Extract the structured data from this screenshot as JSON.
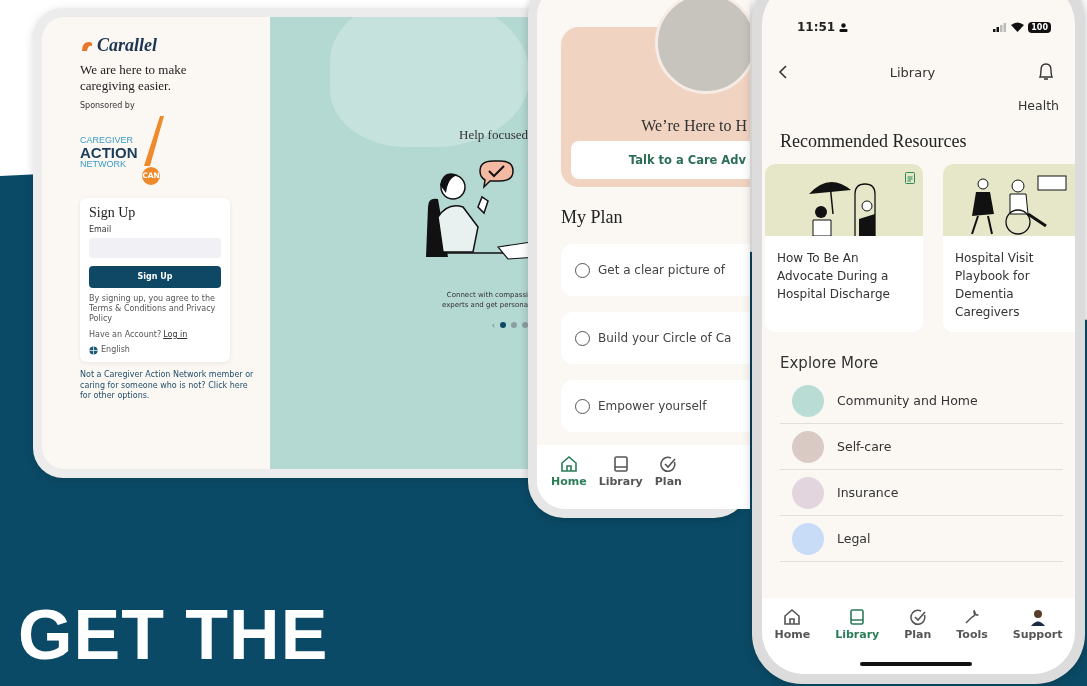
{
  "headline": "GET THE",
  "tablet": {
    "logo": "Carallel",
    "tagline": "We are here to make caregiving easier.",
    "sponsor_label": "Sponsored by",
    "partner_logo_lines": [
      "CAREGIVER",
      "ACTION",
      "NETWORK"
    ],
    "partner_badge": "CAN",
    "signup": {
      "title": "Sign Up",
      "email_label": "Email",
      "button": "Sign Up",
      "terms": "By signing up, you agree to the Terms & Conditions and Privacy Policy",
      "account_prompt": "Have an Account?",
      "login_link": "Log in",
      "language": "English"
    },
    "footer": "Not a Caregiver Action Network member or caring for someone who is not? Click here for other options.",
    "hero": {
      "title": "Help focused",
      "body_lines": [
        "Connect with compassi",
        "experts and get persona"
      ],
      "prev": "‹",
      "dots": [
        {
          "selected": true
        },
        {
          "selected": false
        },
        {
          "selected": false
        }
      ]
    }
  },
  "home_phone": {
    "hero_title": "We’re Here to H",
    "hero_button": "Talk to a Care Adv",
    "section": "My Plan",
    "tasks": [
      {
        "label": "Get a clear picture of",
        "checked": false
      },
      {
        "label": "Build your Circle of Ca",
        "checked": false
      },
      {
        "label": "Empower yourself",
        "checked": false
      }
    ],
    "nav": [
      {
        "label": "Home",
        "selected": true
      },
      {
        "label": "Library",
        "selected": false
      },
      {
        "label": "Plan",
        "selected": false
      }
    ]
  },
  "library_phone": {
    "time": "11:51",
    "battery": "100",
    "title": "Library",
    "tab_partial": "Health",
    "section": "Recommended Resources",
    "resources": [
      {
        "title": "How To Be An Advocate During a Hospital Discharge",
        "document": true
      },
      {
        "title": "Hospital Visit Playbook for Dementia Caregivers",
        "document": false
      }
    ],
    "explore_title": "Explore More",
    "categories": [
      {
        "label": "Community and Home",
        "color": "#b9ddd5"
      },
      {
        "label": "Self-care",
        "color": "#d9cbc4"
      },
      {
        "label": "Insurance",
        "color": "#e3d5de"
      },
      {
        "label": "Legal",
        "color": "#c8dbf7"
      }
    ],
    "nav": [
      {
        "label": "Home",
        "selected": false
      },
      {
        "label": "Library",
        "selected": true
      },
      {
        "label": "Plan",
        "selected": false
      },
      {
        "label": "Tools",
        "selected": false
      },
      {
        "label": "Support",
        "selected": false
      }
    ]
  }
}
